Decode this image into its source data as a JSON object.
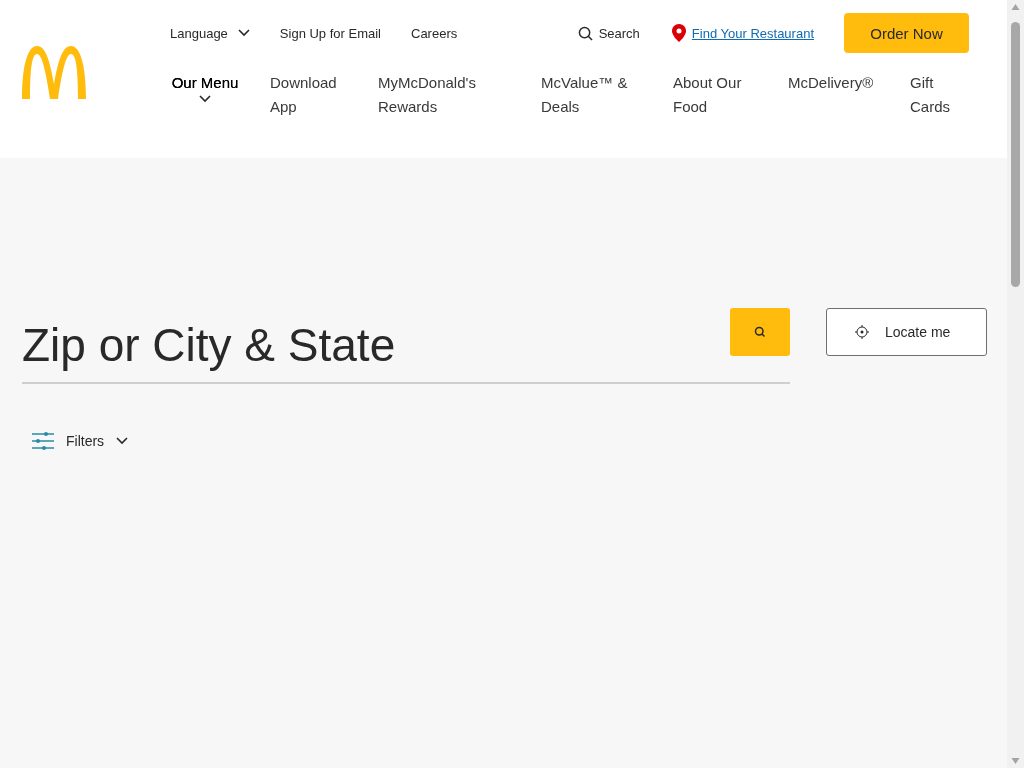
{
  "utility_links": [
    {
      "kind": "dropdown",
      "label": "Language"
    },
    {
      "kind": "link",
      "label": "Sign Up for Email"
    },
    {
      "kind": "link",
      "label": "Careers"
    }
  ],
  "search": {
    "label": "Search"
  },
  "find_restaurant": {
    "label": "Find Your Restaurant"
  },
  "order_button": {
    "label": "Order Now"
  },
  "nav_items": [
    {
      "label": "Our Menu",
      "selected": true,
      "expandable": true
    },
    {
      "label": "Download App",
      "selected": false,
      "expandable": false
    },
    {
      "label": "MyMcDonald's Rewards",
      "selected": false,
      "expandable": false
    },
    {
      "label": "McValue™ & Deals",
      "selected": false,
      "expandable": false
    },
    {
      "label": "About Our Food",
      "selected": false,
      "expandable": false
    },
    {
      "label": "McDelivery®",
      "selected": false,
      "expandable": false
    },
    {
      "label": "Gift Cards",
      "selected": false,
      "expandable": false
    }
  ],
  "locator": {
    "placeholder": "Zip or City & State",
    "locate_button": "Locate me",
    "filters": "Filters"
  }
}
